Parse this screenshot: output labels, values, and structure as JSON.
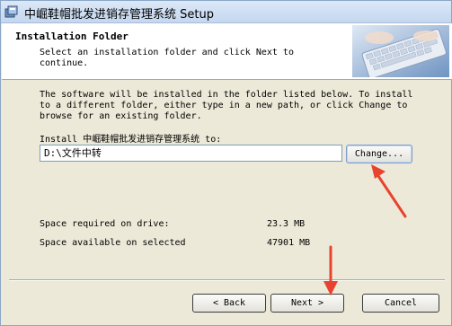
{
  "window": {
    "title": "中崛鞋帽批发进销存管理系统 Setup"
  },
  "header": {
    "title": "Installation Folder",
    "subtitle": "Select an installation folder and click Next to continue."
  },
  "main": {
    "description": "The software will be installed in the folder listed below. To install to a different folder, either type in a new path, or click Change to browse for an existing folder.",
    "install_label": "Install 中崛鞋帽批发进销存管理系统 to:",
    "install_path": "D:\\文件中转",
    "change_label": "Change...",
    "space_required_label": "Space required on drive:",
    "space_required_value": "23.3 MB",
    "space_available_label": "Space available on selected",
    "space_available_value": "47901 MB"
  },
  "footer": {
    "back_label": "< Back",
    "next_label": "Next >",
    "cancel_label": "Cancel"
  },
  "colors": {
    "annotation_arrow": "#e8432f"
  }
}
